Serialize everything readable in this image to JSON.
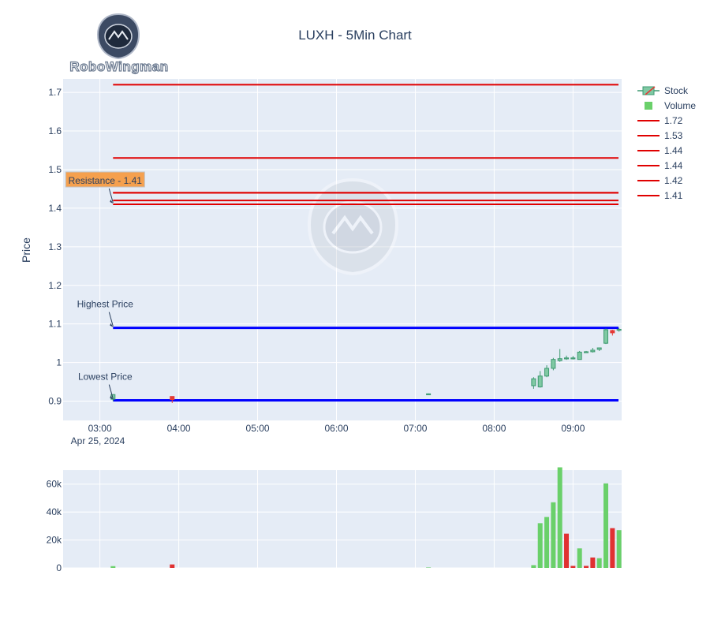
{
  "logo": {
    "text": "RoboWingman"
  },
  "chart_data": [
    {
      "type": "candlestick",
      "title": "LUXH - 5Min Chart",
      "ylabel": "Price",
      "xlabel": "",
      "date_label": "Apr 25, 2024",
      "x_ticks": [
        "03:00",
        "04:00",
        "05:00",
        "06:00",
        "07:00",
        "08:00",
        "09:00"
      ],
      "y_ticks": [
        "0.9",
        "1",
        "1.1",
        "1.2",
        "1.3",
        "1.4",
        "1.5",
        "1.6",
        "1.7"
      ],
      "ylim": [
        0.85,
        1.735
      ],
      "colors": {
        "up": "#3d9970",
        "up_fill": "#7fc9a3",
        "down": "#e53935",
        "support": "#0000ff",
        "resistance": "#e00000"
      },
      "candles": [
        {
          "t": "03:10",
          "o": 0.905,
          "h": 0.918,
          "l": 0.9,
          "c": 0.917
        },
        {
          "t": "03:55",
          "o": 0.912,
          "h": 0.912,
          "l": 0.895,
          "c": 0.904
        },
        {
          "t": "07:10",
          "o": 0.919,
          "h": 0.92,
          "l": 0.918,
          "c": 0.919
        },
        {
          "t": "08:30",
          "o": 0.94,
          "h": 0.962,
          "l": 0.932,
          "c": 0.958
        },
        {
          "t": "08:35",
          "o": 0.937,
          "h": 0.978,
          "l": 0.935,
          "c": 0.965
        },
        {
          "t": "08:40",
          "o": 0.965,
          "h": 0.993,
          "l": 0.962,
          "c": 0.985
        },
        {
          "t": "08:45",
          "o": 0.985,
          "h": 1.012,
          "l": 0.98,
          "c": 1.008
        },
        {
          "t": "08:50",
          "o": 1.005,
          "h": 1.035,
          "l": 1.002,
          "c": 1.01
        },
        {
          "t": "08:55",
          "o": 1.01,
          "h": 1.018,
          "l": 1.007,
          "c": 1.012
        },
        {
          "t": "09:00",
          "o": 1.01,
          "h": 1.017,
          "l": 1.008,
          "c": 1.012
        },
        {
          "t": "09:05",
          "o": 1.008,
          "h": 1.03,
          "l": 1.008,
          "c": 1.027
        },
        {
          "t": "09:10",
          "o": 1.027,
          "h": 1.03,
          "l": 1.025,
          "c": 1.028
        },
        {
          "t": "09:15",
          "o": 1.028,
          "h": 1.038,
          "l": 1.026,
          "c": 1.032
        },
        {
          "t": "09:20",
          "o": 1.034,
          "h": 1.038,
          "l": 1.03,
          "c": 1.038
        },
        {
          "t": "09:25",
          "o": 1.05,
          "h": 1.088,
          "l": 1.048,
          "c": 1.085
        },
        {
          "t": "09:30",
          "o": 1.083,
          "h": 1.085,
          "l": 1.07,
          "c": 1.077
        },
        {
          "t": "09:35",
          "o": 1.084,
          "h": 1.09,
          "l": 1.08,
          "c": 1.086
        }
      ],
      "resistance_lines": [
        1.72,
        1.53,
        1.44,
        1.44,
        1.42,
        1.41
      ],
      "support_lines": [
        1.09,
        0.902
      ],
      "line_start": "03:10",
      "annotations": [
        {
          "text": "Resistance - 1.41",
          "t": "03:10",
          "y": 1.41,
          "boxed": true
        },
        {
          "text": "Highest Price",
          "t": "03:10",
          "y": 1.09,
          "boxed": false
        },
        {
          "text": "Lowest Price",
          "t": "03:10",
          "y": 0.902,
          "boxed": false
        }
      ],
      "legend": [
        "Stock",
        "Volume",
        "1.72",
        "1.53",
        "1.44",
        "1.44",
        "1.42",
        "1.41"
      ],
      "legend_position": "right"
    },
    {
      "type": "bar",
      "title": "",
      "ylabel": "",
      "y_ticks": [
        "0",
        "20k",
        "40k",
        "60k"
      ],
      "ylim": [
        0,
        70000
      ],
      "bars": [
        {
          "t": "03:10",
          "v": 1300,
          "dir": "up"
        },
        {
          "t": "03:55",
          "v": 2500,
          "dir": "down"
        },
        {
          "t": "07:10",
          "v": 300,
          "dir": "up"
        },
        {
          "t": "08:30",
          "v": 2000,
          "dir": "up"
        },
        {
          "t": "08:35",
          "v": 32000,
          "dir": "up"
        },
        {
          "t": "08:40",
          "v": 36500,
          "dir": "up"
        },
        {
          "t": "08:45",
          "v": 47000,
          "dir": "up"
        },
        {
          "t": "08:50",
          "v": 72000,
          "dir": "up"
        },
        {
          "t": "08:55",
          "v": 24500,
          "dir": "down"
        },
        {
          "t": "09:00",
          "v": 1500,
          "dir": "down"
        },
        {
          "t": "09:05",
          "v": 14000,
          "dir": "up"
        },
        {
          "t": "09:10",
          "v": 1500,
          "dir": "down"
        },
        {
          "t": "09:15",
          "v": 7500,
          "dir": "down"
        },
        {
          "t": "09:20",
          "v": 7000,
          "dir": "up"
        },
        {
          "t": "09:25",
          "v": 60500,
          "dir": "up"
        },
        {
          "t": "09:30",
          "v": 28500,
          "dir": "down"
        },
        {
          "t": "09:35",
          "v": 27000,
          "dir": "up"
        }
      ],
      "colors": {
        "up": "#6ad06a",
        "down": "#e03131"
      }
    }
  ]
}
